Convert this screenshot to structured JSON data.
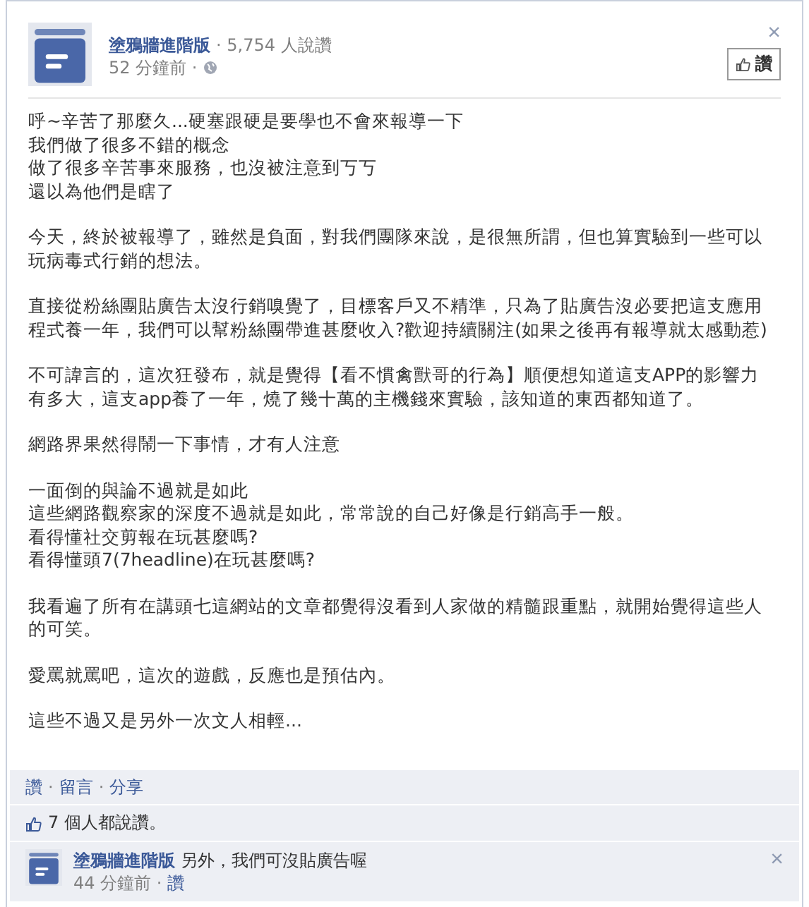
{
  "post": {
    "page_name": "塗鴉牆進階版",
    "like_count": "· 5,754 人說讚",
    "time": "52 分鐘前 ·",
    "like_button": "讚",
    "close": "×"
  },
  "paragraphs": [
    {
      "lines": [
        "呼~辛苦了那麼久...硬塞跟硬是要學也不會來報導一下",
        "我們做了很多不錯的概念",
        "做了很多辛苦事來服務，也沒被注意到丂丂",
        "還以為他們是瞎了"
      ]
    },
    {
      "lines": [
        "今天，終於被報導了，雖然是負面，對我們團隊來說，是很無所謂，但也算實驗到一些可以玩病毒式行銷的想法。"
      ]
    },
    {
      "lines": [
        "直接從粉絲團貼廣告太沒行銷嗅覺了，目標客戶又不精準，只為了貼廣告沒必要把這支應用程式養一年，我們可以幫粉絲團帶進甚麼收入?歡迎持續關注(如果之後再有報導就太感動惹)"
      ]
    },
    {
      "lines": [
        "不可諱言的，這次狂發布，就是覺得【看不慣禽獸哥的行為】順便想知道這支APP的影響力有多大，這支app養了一年，燒了幾十萬的主機錢來實驗，該知道的東西都知道了。"
      ]
    },
    {
      "lines": [
        "網路界果然得鬧一下事情，才有人注意"
      ]
    },
    {
      "lines": [
        "一面倒的與論不過就是如此",
        "這些網路觀察家的深度不過就是如此，常常說的自己好像是行銷高手一般。",
        "看得懂社交剪報在玩甚麼嗎?",
        "看得懂頭7(7headline)在玩甚麼嗎?"
      ]
    },
    {
      "lines": [
        "我看遍了所有在講頭七這網站的文章都覺得沒看到人家做的精髓跟重點，就開始覺得這些人的可笑。"
      ]
    },
    {
      "lines": [
        "愛罵就罵吧，這次的遊戲，反應也是預估內。"
      ]
    },
    {
      "lines": [
        "這些不過又是另外一次文人相輕..."
      ]
    }
  ],
  "actions": [
    "讚",
    "留言",
    "分享"
  ],
  "action_separator": "·",
  "likes": "7 個人都說讚。",
  "comments": [
    {
      "author": "塗鴉牆進階版",
      "text": "另外，我們可沒貼廣告喔",
      "time": "44 分鐘前 ·",
      "like": "讚",
      "close": "×"
    }
  ]
}
